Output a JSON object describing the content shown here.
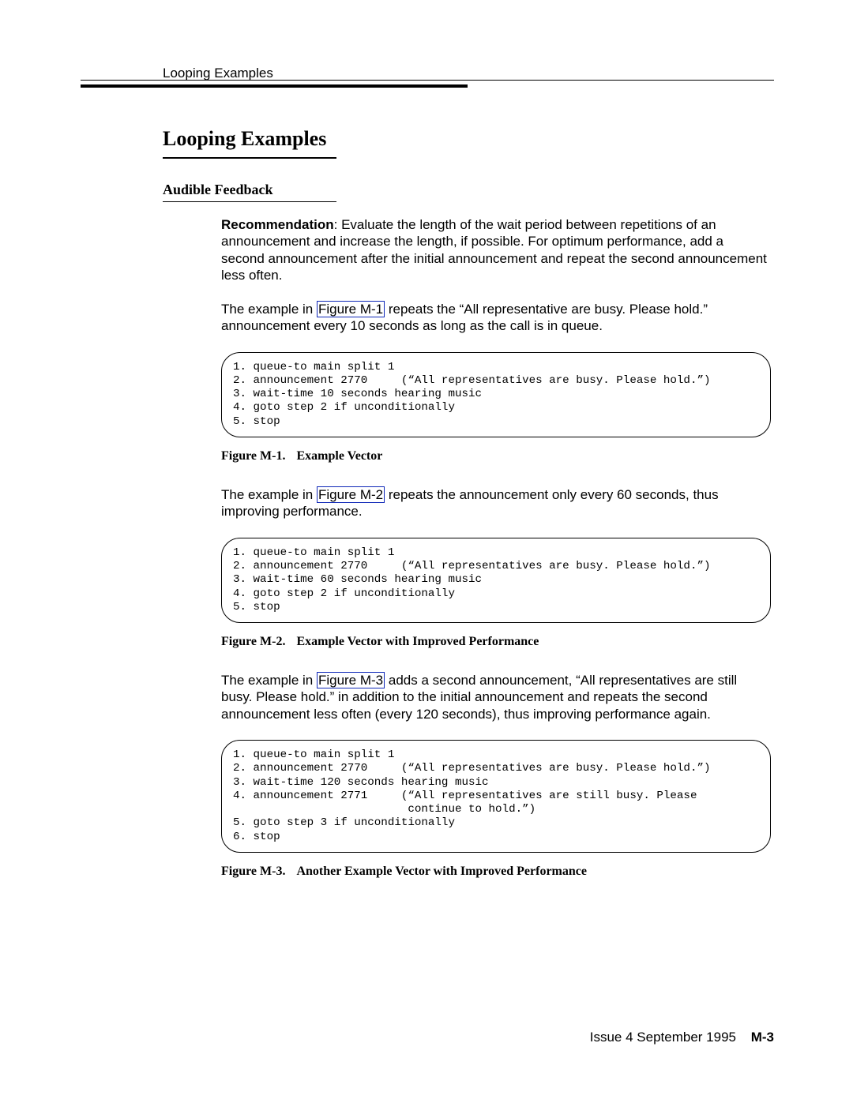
{
  "running_head": "Looping Examples",
  "section_title": "Looping Examples",
  "subsection_title": "Audible Feedback",
  "paragraphs": {
    "p1_lead": "Recommendation",
    "p1_rest": ": Evaluate the length of the wait period between repetitions of an announcement and increase the length, if possible. For optimum performance, add a second announcement after the initial announcement and repeat the second announcement less often.",
    "p2_before": "The example in ",
    "p2_ref": "Figure M-1",
    "p2_after": " repeats the “All representative are busy. Please hold.” announcement every 10 seconds as long as the call is in queue.",
    "p3_before": "The example in ",
    "p3_ref": "Figure M-2",
    "p3_after": " repeats the announcement only every 60 seconds, thus improving performance.",
    "p4_before": "The example in ",
    "p4_ref": "Figure M-3",
    "p4_after": " adds a second announcement, “All representatives are still busy. Please hold.” in addition to the initial announcement and repeats the second announcement less often (every 120 seconds), thus improving performance again."
  },
  "figures": {
    "f1_code": "1. queue-to main split 1\n2. announcement 2770     (“All representatives are busy. Please hold.”)\n3. wait-time 10 seconds hearing music\n4. goto step 2 if unconditionally\n5. stop",
    "f1_cap_num": "Figure M-1.",
    "f1_cap_title": "Example Vector",
    "f2_code": "1. queue-to main split 1\n2. announcement 2770     (“All representatives are busy. Please hold.”)\n3. wait-time 60 seconds hearing music\n4. goto step 2 if unconditionally\n5. stop",
    "f2_cap_num": "Figure M-2.",
    "f2_cap_title": "Example Vector with Improved Performance",
    "f3_code": "1. queue-to main split 1\n2. announcement 2770     (“All representatives are busy. Please hold.”)\n3. wait-time 120 seconds hearing music\n4. announcement 2771     (“All representatives are still busy. Please\n                          continue to hold.”)\n5. goto step 3 if unconditionally\n6. stop",
    "f3_cap_num": "Figure M-3.",
    "f3_cap_title": "Another Example Vector with Improved Performance"
  },
  "footer": {
    "issue": "Issue  4 September 1995",
    "page": "M-3"
  }
}
